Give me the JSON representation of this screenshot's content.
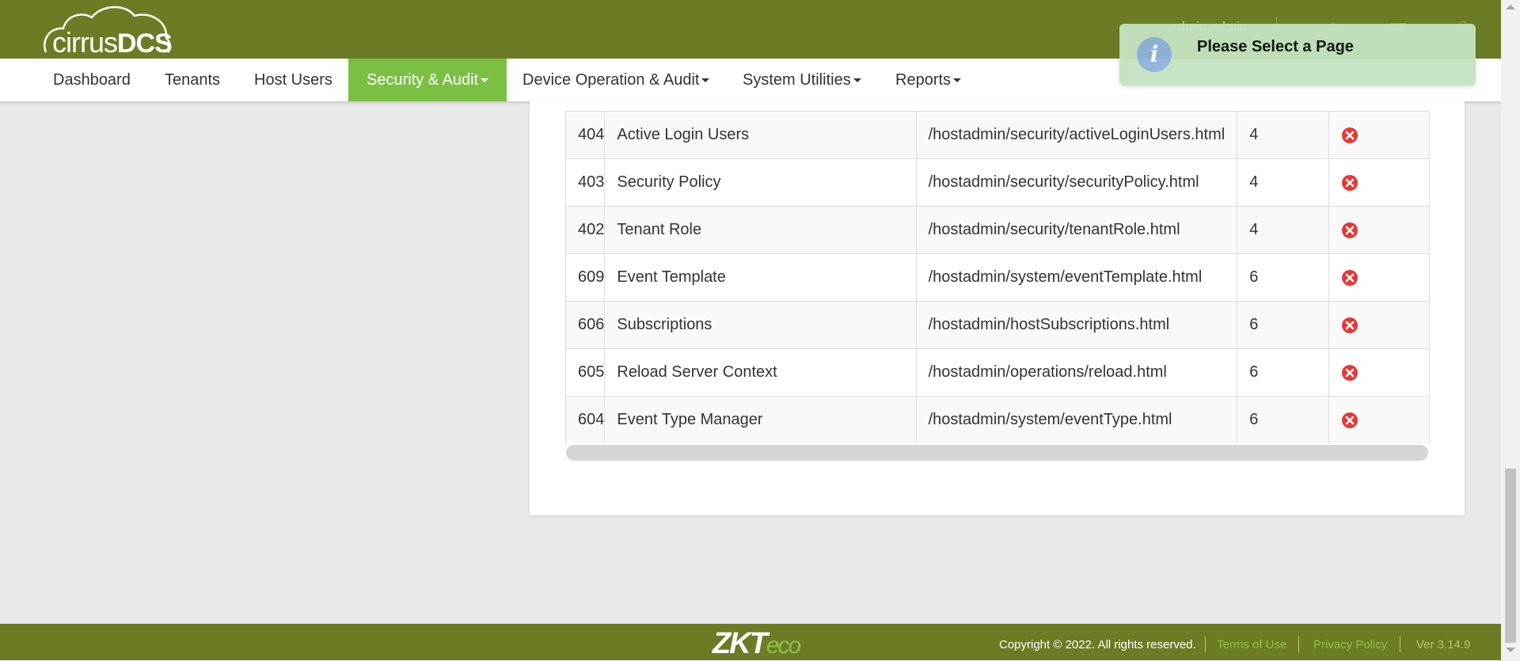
{
  "app": {
    "logo_text_light": "cirrus",
    "logo_text_bold": "DCS",
    "user_label": "admin admin"
  },
  "nav": {
    "items": [
      {
        "label": "Dashboard"
      },
      {
        "label": "Tenants"
      },
      {
        "label": "Host Users"
      },
      {
        "label": "Security & Audit",
        "active": true
      },
      {
        "label": "Device Operation & Audit"
      },
      {
        "label": "System Utilities"
      },
      {
        "label": "Reports"
      }
    ]
  },
  "toast": {
    "message": "Please Select a Page"
  },
  "table": {
    "rows": [
      {
        "id": "404",
        "name": "Active Login Users",
        "url": "/hostadmin/security/activeLoginUsers.html",
        "group": "4"
      },
      {
        "id": "403",
        "name": "Security Policy",
        "url": "/hostadmin/security/securityPolicy.html",
        "group": "4"
      },
      {
        "id": "402",
        "name": "Tenant Role",
        "url": "/hostadmin/security/tenantRole.html",
        "group": "4"
      },
      {
        "id": "609",
        "name": "Event Template",
        "url": "/hostadmin/system/eventTemplate.html",
        "group": "6"
      },
      {
        "id": "606",
        "name": "Subscriptions",
        "url": "/hostadmin/hostSubscriptions.html",
        "group": "6"
      },
      {
        "id": "605",
        "name": "Reload Server Context",
        "url": "/hostadmin/operations/reload.html",
        "group": "6"
      },
      {
        "id": "604",
        "name": "Event Type Manager",
        "url": "/hostadmin/system/eventType.html",
        "group": "6"
      }
    ]
  },
  "footer": {
    "brand_main": "ZKT",
    "brand_sub": "eco",
    "copyright": "Copyright © 2022. All rights reserved.",
    "terms": "Terms of Use",
    "privacy": "Privacy Policy",
    "version": "Ver 3.14.9"
  },
  "colors": {
    "brand_green": "#6c7c25",
    "active_tab": "#7bc043",
    "delete_red": "#e53935",
    "toast_bg": "#c3e3c0"
  }
}
